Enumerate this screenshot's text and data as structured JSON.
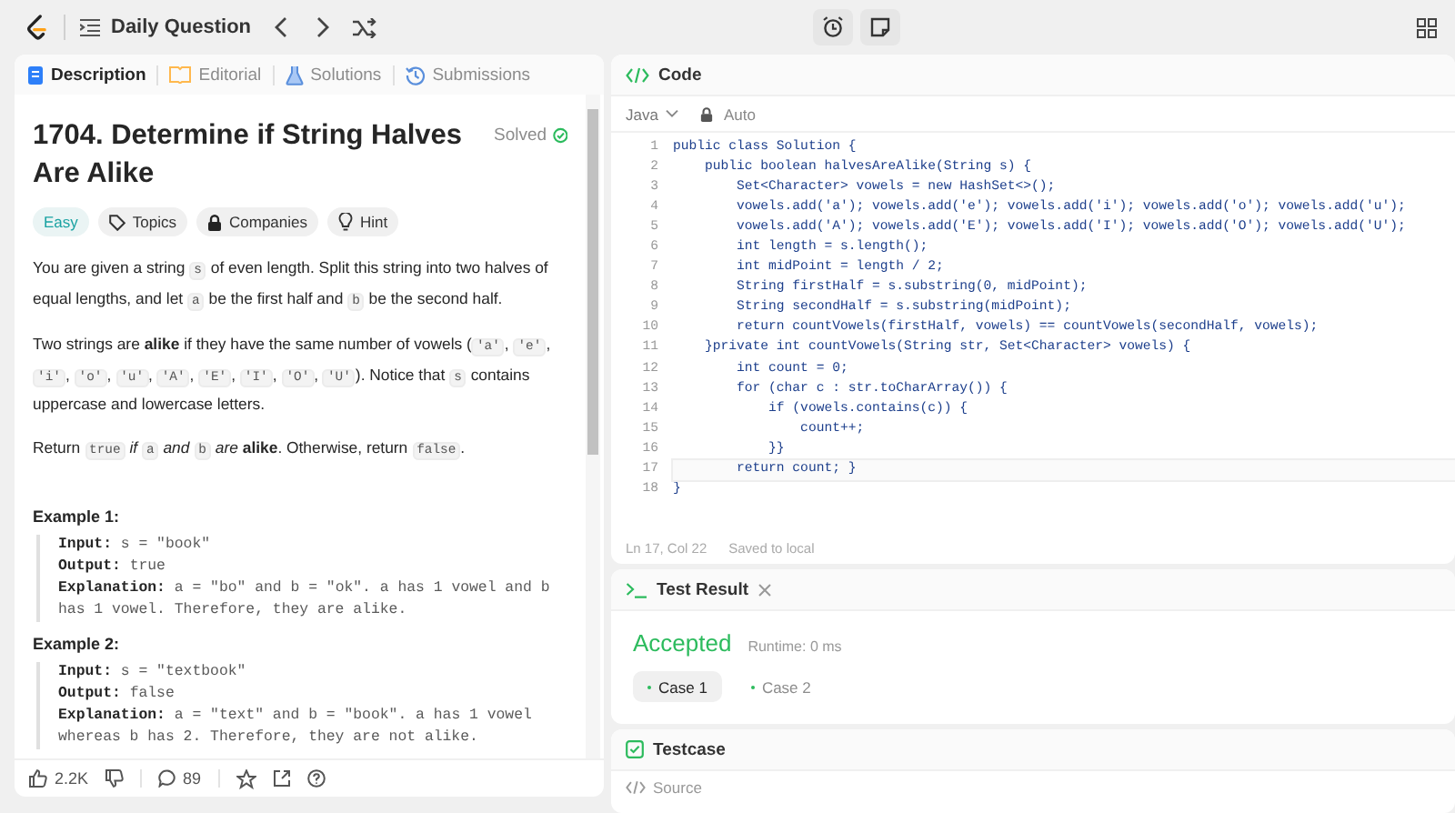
{
  "topbar": {
    "title": "Daily Question"
  },
  "tabs": [
    {
      "label": "Description",
      "selected": true
    },
    {
      "label": "Editorial",
      "selected": false
    },
    {
      "label": "Solutions",
      "selected": false
    },
    {
      "label": "Submissions",
      "selected": false
    }
  ],
  "problem": {
    "title": "1704. Determine if String Halves Are Alike",
    "status": "Solved",
    "difficulty": "Easy",
    "tags": [
      "Topics",
      "Companies",
      "Hint"
    ],
    "paragraphs": [
      [
        {
          "kind": "text",
          "text": "You are given a string "
        },
        {
          "kind": "code",
          "text": "s"
        },
        {
          "kind": "text",
          "text": " of even length. Split this string into two halves of equal lengths, and let "
        },
        {
          "kind": "code",
          "text": "a"
        },
        {
          "kind": "text",
          "text": " be the first half and "
        },
        {
          "kind": "code",
          "text": "b"
        },
        {
          "kind": "text",
          "text": " be the second half."
        }
      ],
      [
        {
          "kind": "text",
          "text": "Two strings are **alike** if they have the same number of vowels ("
        },
        {
          "kind": "code",
          "text": "'a'"
        },
        {
          "kind": "text",
          "text": ", "
        },
        {
          "kind": "code",
          "text": "'e'"
        },
        {
          "kind": "text",
          "text": ", "
        },
        {
          "kind": "code",
          "text": "'i'"
        },
        {
          "kind": "text",
          "text": ", "
        },
        {
          "kind": "code",
          "text": "'o'"
        },
        {
          "kind": "text",
          "text": ", "
        },
        {
          "kind": "code",
          "text": "'u'"
        },
        {
          "kind": "text",
          "text": ", "
        },
        {
          "kind": "code",
          "text": "'A'"
        },
        {
          "kind": "text",
          "text": ", "
        },
        {
          "kind": "code",
          "text": "'E'"
        },
        {
          "kind": "text",
          "text": ", "
        },
        {
          "kind": "code",
          "text": "'I'"
        },
        {
          "kind": "text",
          "text": ", "
        },
        {
          "kind": "code",
          "text": "'O'"
        },
        {
          "kind": "text",
          "text": ", "
        },
        {
          "kind": "code",
          "text": "'U'"
        },
        {
          "kind": "text",
          "text": "). Notice that "
        },
        {
          "kind": "code",
          "text": "s"
        },
        {
          "kind": "text",
          "text": " contains uppercase and lowercase letters."
        }
      ],
      [
        {
          "kind": "text",
          "text": "Return "
        },
        {
          "kind": "code",
          "text": "true"
        },
        {
          "kind": "text",
          "text": " *if* "
        },
        {
          "kind": "code",
          "text": "a"
        },
        {
          "kind": "text",
          "text": " *and* "
        },
        {
          "kind": "code",
          "text": "b"
        },
        {
          "kind": "text",
          "text": " *are* **alike**. Otherwise, return "
        },
        {
          "kind": "code",
          "text": "false"
        },
        {
          "kind": "text",
          "text": "."
        }
      ]
    ],
    "examples": [
      {
        "heading": "Example 1:",
        "lines": [
          "**Input:** s = \"book\"",
          "**Output:** true",
          "**Explanation:** a = \"bo\" and b = \"ok\". a has 1 vowel and b has 1 vowel. Therefore, they are alike."
        ]
      },
      {
        "heading": "Example 2:",
        "lines": [
          "**Input:** s = \"textbook\"",
          "**Output:** false",
          "**Explanation:** a = \"text\" and b = \"book\". a has 1 vowel whereas b has 2. Therefore, they are not alike."
        ]
      }
    ]
  },
  "footer": {
    "likes": "2.2K",
    "comments": "89"
  },
  "code": {
    "title": "Code",
    "language": "Java",
    "mode": "Auto",
    "lines": [
      "public class Solution {",
      "    public boolean halvesAreAlike(String s) {",
      "        Set<Character> vowels = new HashSet<>();",
      "        vowels.add('a'); vowels.add('e'); vowels.add('i'); vowels.add('o'); vowels.add('u');",
      "        vowels.add('A'); vowels.add('E'); vowels.add('I'); vowels.add('O'); vowels.add('U');",
      "        int length = s.length();",
      "        int midPoint = length / 2;",
      "        String firstHalf = s.substring(0, midPoint);",
      "        String secondHalf = s.substring(midPoint);",
      "        return countVowels(firstHalf, vowels) == countVowels(secondHalf, vowels);",
      "    }private int countVowels(String str, Set<Character> vowels) {",
      "        int count = 0;",
      "        for (char c : str.toCharArray()) {",
      "            if (vowels.contains(c)) {",
      "                count++;",
      "            }}",
      "        return count; }",
      "}"
    ],
    "numbers": [
      "1",
      "2",
      "3",
      "4",
      "5",
      "6",
      "7",
      "8",
      "9",
      "10",
      "11",
      "12",
      "13",
      "14",
      "15",
      "16",
      "17",
      "18"
    ],
    "cursor": "Ln 17, Col 22",
    "saved": "Saved to local"
  },
  "test_result": {
    "title": "Test Result",
    "verdict": "Accepted",
    "runtime": "Runtime: 0 ms",
    "cases": [
      {
        "label": "Case 1",
        "selected": true
      },
      {
        "label": "Case 2",
        "selected": false
      }
    ]
  },
  "testcase": {
    "title": "Testcase",
    "source": "Source"
  }
}
